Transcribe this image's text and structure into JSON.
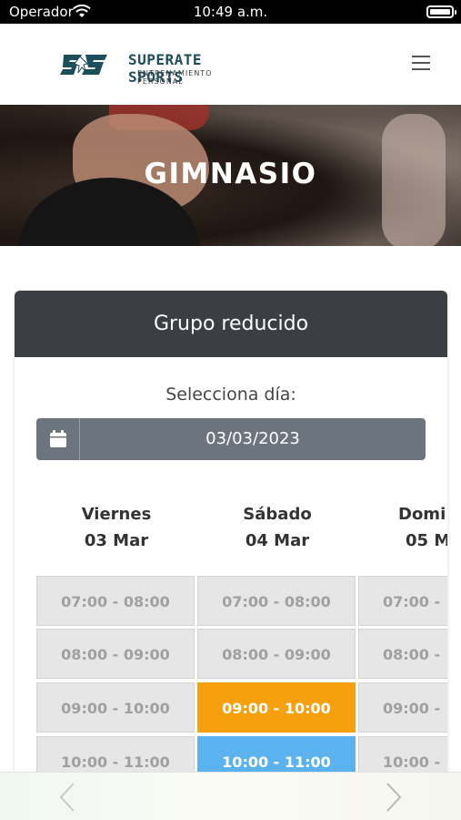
{
  "status": {
    "carrier": "Operador",
    "time": "10:49 a.m."
  },
  "header": {
    "brand": "SUPERATE SPORTS",
    "tagline": "ENTRENAMIENTO PERSONAL"
  },
  "hero": {
    "title": "GIMNASIO"
  },
  "card": {
    "title": "Grupo reducido",
    "select_label": "Selecciona día:",
    "date_value": "03/03/2023"
  },
  "days": [
    {
      "name": "Viernes",
      "date": "03 Mar"
    },
    {
      "name": "Sábado",
      "date": "04 Mar"
    },
    {
      "name": "Domi",
      "date": "05 M"
    }
  ],
  "slots": [
    [
      "07:00 - 08:00",
      "07:00 - 08:00",
      "07:00 -"
    ],
    [
      "08:00 - 09:00",
      "08:00 - 09:00",
      "08:00 -"
    ],
    [
      "09:00 - 10:00",
      "09:00 - 10:00",
      "09:00 -"
    ],
    [
      "10:00 - 11:00",
      "10:00 - 11:00",
      "10:00 -"
    ]
  ],
  "colors": {
    "selected_orange": "#f7a00f",
    "selected_blue": "#5ab3ee",
    "card_header": "#3b3f43",
    "date_picker": "#6c757d",
    "brand": "#1c4f5b"
  },
  "icons": {
    "wifi": "wifi-icon",
    "battery": "battery-icon",
    "menu": "hamburger-menu-icon",
    "calendar": "calendar-icon",
    "back": "chevron-left-icon",
    "forward": "chevron-right-icon"
  }
}
